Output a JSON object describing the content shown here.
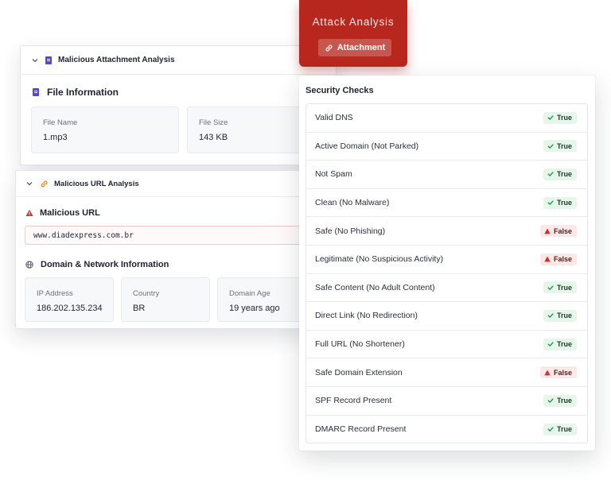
{
  "banner": {
    "title": "Attack Analysis",
    "tag": "Attachment"
  },
  "attachment_card": {
    "header": "Malicious Attachment Analysis",
    "section": "File Information",
    "fields": [
      {
        "label": "File Name",
        "value": "1.mp3"
      },
      {
        "label": "File Size",
        "value": "143 KB"
      }
    ]
  },
  "url_card": {
    "header": "Malicious URL Analysis",
    "url_section": "Malicious URL",
    "url": "www.diadexpress.com.br",
    "network_section": "Domain & Network Information",
    "fields": [
      {
        "label": "IP Address",
        "value": "186.202.135.234"
      },
      {
        "label": "Country",
        "value": "BR"
      },
      {
        "label": "Domain Age",
        "value": "19 years ago"
      }
    ]
  },
  "security": {
    "title": "Security Checks",
    "checks": [
      {
        "label": "Valid DNS",
        "result": "True"
      },
      {
        "label": "Active Domain (Not Parked)",
        "result": "True"
      },
      {
        "label": "Not Spam",
        "result": "True"
      },
      {
        "label": "Clean (No Malware)",
        "result": "True"
      },
      {
        "label": "Safe (No Phishing)",
        "result": "False"
      },
      {
        "label": "Legitimate (No Suspicious Activity)",
        "result": "False"
      },
      {
        "label": "Safe Content (No Adult Content)",
        "result": "True"
      },
      {
        "label": "Direct Link (No Redirection)",
        "result": "True"
      },
      {
        "label": "Full URL (No Shortener)",
        "result": "True"
      },
      {
        "label": "Safe Domain Extension",
        "result": "False"
      },
      {
        "label": "SPF Record Present",
        "result": "True"
      },
      {
        "label": "DMARC Record Present",
        "result": "True"
      }
    ]
  },
  "colors": {
    "banner_red": "#b8271d",
    "true_bg": "#e6f6ea",
    "true_check": "#22a04b",
    "false_bg": "#fde8e8",
    "false_warn": "#d32f2f",
    "doc_icon": "#4f46e5",
    "link_icon": "#e0892b"
  },
  "icons": [
    "chevron-down-icon",
    "document-icon",
    "link-icon",
    "warning-icon",
    "globe-icon",
    "check-icon"
  ]
}
